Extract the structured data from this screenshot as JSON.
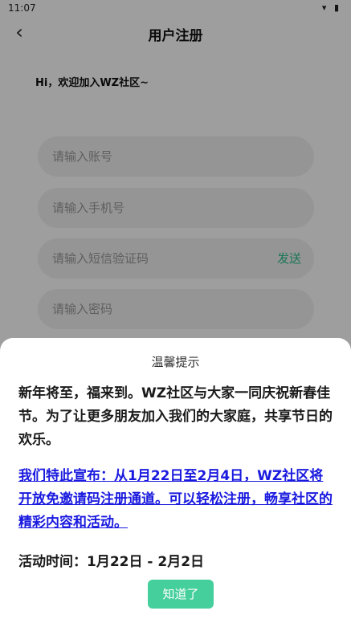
{
  "statusbar": {
    "time": "11:07",
    "icons": "▾ ▮"
  },
  "appbar": {
    "back_glyph": "‹",
    "title": "用户注册"
  },
  "form": {
    "greeting": "Hi，欢迎加入WZ社区~",
    "account_placeholder": "请输入账号",
    "phone_placeholder": "请输入手机号",
    "code_placeholder": "请输入短信验证码",
    "send_label": "发送",
    "password_placeholder": "请输入密码"
  },
  "dialog": {
    "title": "温馨提示",
    "paragraph1": "新年将至，福来到。WZ社区与大家一同庆祝新春佳节。为了让更多朋友加入我们的大家庭，共享节日的欢乐。",
    "paragraph2": "我们特此宣布：从1月22日至2月4日，WZ社区将开放免邀请码注册通道。可以轻松注册，畅享社区的精彩内容和活动。",
    "period": "活动时间：1月22日 - 2月2日",
    "ok_label": "知道了"
  },
  "colors": {
    "accent": "#44cf9c",
    "link": "#1a1adf",
    "send": "#2bbf8b"
  }
}
